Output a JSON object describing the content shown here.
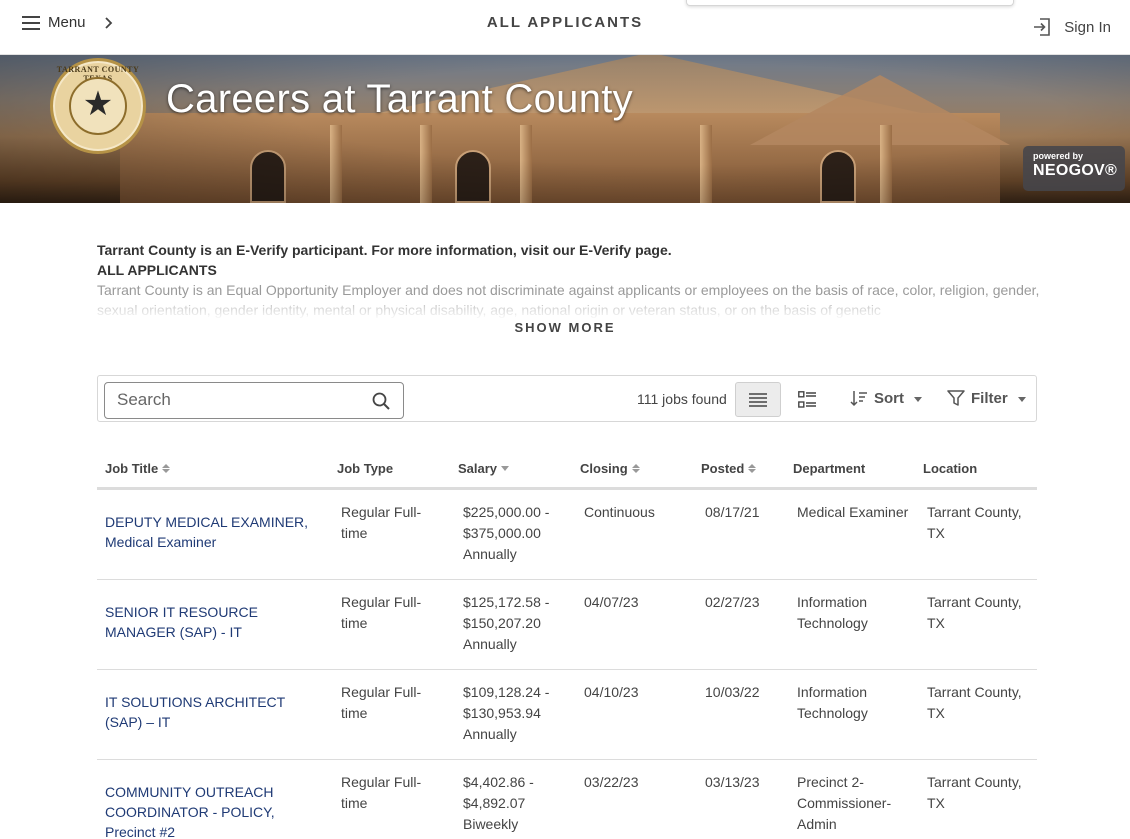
{
  "header": {
    "menu_label": "Menu",
    "page_title": "ALL APPLICANTS",
    "signin_label": "Sign In"
  },
  "banner": {
    "title": "Careers at Tarrant County",
    "seal_text": "TARRANT COUNTY TEXAS",
    "powered_by": "powered by",
    "neogov": "NEOGOV®"
  },
  "info": {
    "everify": "Tarrant County is an E-Verify participant. For more information, visit our E-Verify page.",
    "heading": "ALL APPLICANTS",
    "eeo": "Tarrant County is an Equal Opportunity Employer and does not discriminate against applicants or employees on the basis of race, color, religion, gender, sexual orientation, gender identity, mental or physical disability, age, national origin or veteran status, or on the basis of genetic",
    "show_more": "SHOW MORE"
  },
  "toolbar": {
    "search_placeholder": "Search",
    "jobs_found": "111 jobs found",
    "sort_label": "Sort",
    "filter_label": "Filter"
  },
  "table": {
    "columns": [
      "Job Title",
      "Job Type",
      "Salary",
      "Closing",
      "Posted",
      "Department",
      "Location"
    ],
    "rows": [
      {
        "title": "DEPUTY MEDICAL EXAMINER, Medical Examiner",
        "type": "Regular Full-time",
        "salary": "$225,000.00 - $375,000.00 Annually",
        "closing": "Continuous",
        "posted": "08/17/21",
        "department": "Medical Examiner",
        "location": "Tarrant County, TX"
      },
      {
        "title": "SENIOR IT RESOURCE MANAGER (SAP) - IT",
        "type": "Regular Full-time",
        "salary": "$125,172.58 - $150,207.20 Annually",
        "closing": "04/07/23",
        "posted": "02/27/23",
        "department": "Information Technology",
        "location": "Tarrant County, TX"
      },
      {
        "title": "IT SOLUTIONS ARCHITECT (SAP) – IT",
        "type": "Regular Full-time",
        "salary": "$109,128.24 - $130,953.94 Annually",
        "closing": "04/10/23",
        "posted": "10/03/22",
        "department": "Information Technology",
        "location": "Tarrant County, TX"
      },
      {
        "title": "COMMUNITY OUTREACH COORDINATOR - POLICY, Precinct #2",
        "type": "Regular Full-time",
        "salary": "$4,402.86 - $4,892.07 Biweekly",
        "closing": "03/22/23",
        "posted": "03/13/23",
        "department": "Precinct 2-Commissioner-Admin",
        "location": "Tarrant County, TX"
      }
    ]
  },
  "colors": {
    "link": "#1f3a75",
    "text": "#444444",
    "border": "#dcdcdc"
  }
}
